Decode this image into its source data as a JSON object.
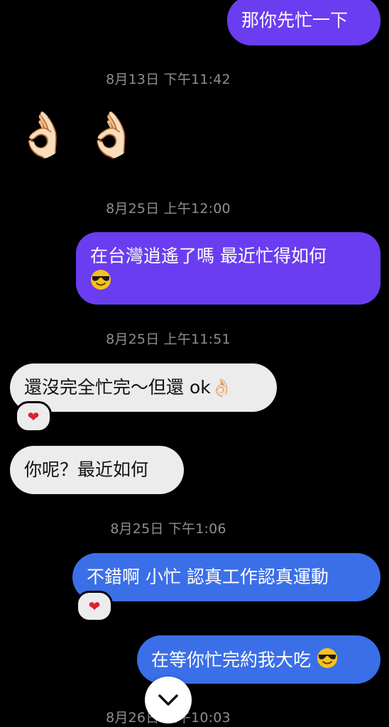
{
  "messages": [
    {
      "type": "out",
      "text": "那你先忙一下"
    },
    {
      "type": "timestamp",
      "text": "8月13日 下午11:42"
    },
    {
      "type": "in_emoji",
      "text": "👌🏻 👌🏻"
    },
    {
      "type": "timestamp",
      "text": "8月25日 上午12:00"
    },
    {
      "type": "out",
      "line1": "在台灣逍遙了嗎 最近忙得如何",
      "emoji": "😎"
    },
    {
      "type": "timestamp",
      "text": "8月25日 上午11:51"
    },
    {
      "type": "in",
      "text": "還沒完全忙完～但還 ok👌🏻",
      "reaction": "❤"
    },
    {
      "type": "in",
      "text": "你呢？最近如何"
    },
    {
      "type": "timestamp",
      "text": "8月25日 下午1:06"
    },
    {
      "type": "out",
      "text": "不錯啊 小忙 認真工作認真運動",
      "reaction": "❤"
    },
    {
      "type": "out",
      "text": "在等你忙完約我大吃",
      "emoji": "😎"
    },
    {
      "type": "timestamp",
      "text": "8月26日 上午10:03"
    }
  ],
  "colors": {
    "purple": "#6a3df0",
    "blue": "#3b6fe8",
    "incoming": "#ececec",
    "timestamp": "#8e8e93"
  },
  "icons": {
    "scroll": "chevron-down-icon",
    "reaction": "heart-icon"
  }
}
